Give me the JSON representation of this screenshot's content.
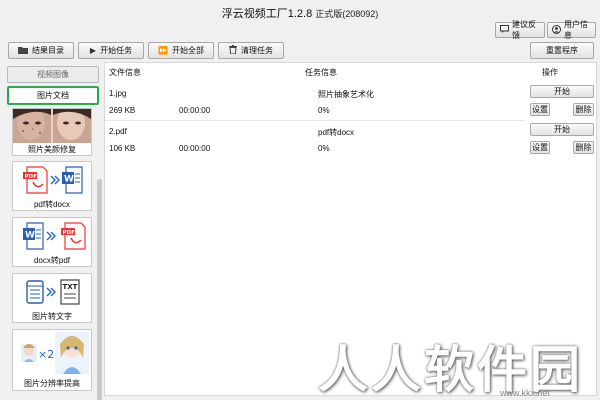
{
  "window": {
    "title_main": "浮云视频工厂1.2.8",
    "title_version": "正式版(208092)"
  },
  "top_buttons": {
    "feedback": "建议反馈",
    "user_info": "用户信息"
  },
  "toolbar": {
    "result_dir": "结果目录",
    "start_task": "开始任务",
    "start_all": "开始全部",
    "clear_tasks": "清理任务",
    "restart": "重置程序"
  },
  "sidebar": {
    "tab_video": "视频图像",
    "tab_docs": "图片文档",
    "tools": [
      {
        "label": "照片美颜修复",
        "icon": "photo-retouch-icon"
      },
      {
        "label": "pdf转docx",
        "icon": "pdf-to-word-icon"
      },
      {
        "label": "docx转pdf",
        "icon": "word-to-pdf-icon"
      },
      {
        "label": "图片转文字",
        "icon": "image-to-text-icon"
      },
      {
        "label": "图片分辨率提高",
        "icon": "upscale-icon"
      }
    ]
  },
  "table": {
    "col_file": "文件信息",
    "col_task": "任务信息",
    "col_action": "操作",
    "rows": [
      {
        "name": "1.jpg",
        "size": "269 KB",
        "time": "00:00:00",
        "task": "照片抽象艺术化",
        "progress": "0%",
        "start": "开始",
        "settings": "设置",
        "delete": "删除"
      },
      {
        "name": "2.pdf",
        "size": "106 KB",
        "time": "00:00:00",
        "task": "pdf转docx",
        "progress": "0%",
        "start": "开始",
        "settings": "设置",
        "delete": "删除"
      }
    ]
  },
  "watermark": {
    "text": "人人软件园",
    "url": "www.kkx.net"
  }
}
